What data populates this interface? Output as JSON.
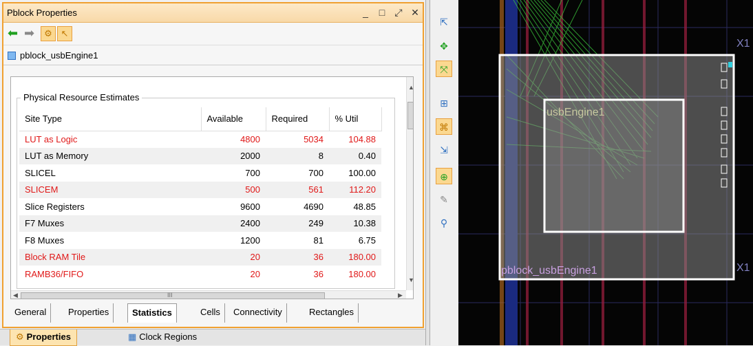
{
  "window": {
    "title": "Pblock Properties",
    "minimize": "_",
    "maximize": "□",
    "float": "⤢",
    "close": "✕"
  },
  "object": {
    "name": "pblock_usbEngine1"
  },
  "panel": {
    "group_title": "Physical Resource Estimates",
    "columns": [
      "Site Type",
      "Available",
      "Required",
      "% Util"
    ],
    "rows": [
      {
        "site": "LUT as Logic",
        "available": "4800",
        "required": "5034",
        "util": "104.88",
        "over": true
      },
      {
        "site": "LUT as Memory",
        "available": "2000",
        "required": "8",
        "util": "0.40",
        "over": false
      },
      {
        "site": "SLICEL",
        "available": "700",
        "required": "700",
        "util": "100.00",
        "over": false
      },
      {
        "site": "SLICEM",
        "available": "500",
        "required": "561",
        "util": "112.20",
        "over": true
      },
      {
        "site": "Slice Registers",
        "available": "9600",
        "required": "4690",
        "util": "48.85",
        "over": false
      },
      {
        "site": "F7 Muxes",
        "available": "2400",
        "required": "249",
        "util": "10.38",
        "over": false
      },
      {
        "site": "F8 Muxes",
        "available": "1200",
        "required": "81",
        "util": "6.75",
        "over": false
      },
      {
        "site": "Block RAM Tile",
        "available": "20",
        "required": "36",
        "util": "180.00",
        "over": true
      },
      {
        "site": "RAMB36/FIFO",
        "available": "20",
        "required": "36",
        "util": "180.00",
        "over": true
      }
    ],
    "scroll_glyph": "III"
  },
  "tabs": [
    "General",
    "Properties",
    "Statistics",
    "Cells",
    "Connectivity",
    "Rectangles"
  ],
  "active_tab": "Statistics",
  "bottom_tabs": [
    "Properties",
    "Clock Regions"
  ],
  "device": {
    "label_inner": "usbEngine1",
    "label_outer": "pblock_usbEngine1",
    "label_x1_top": "X1",
    "label_x1_bottom": "X1",
    "highlight_color": "#ffffff",
    "net_color": "#3cc83c"
  }
}
